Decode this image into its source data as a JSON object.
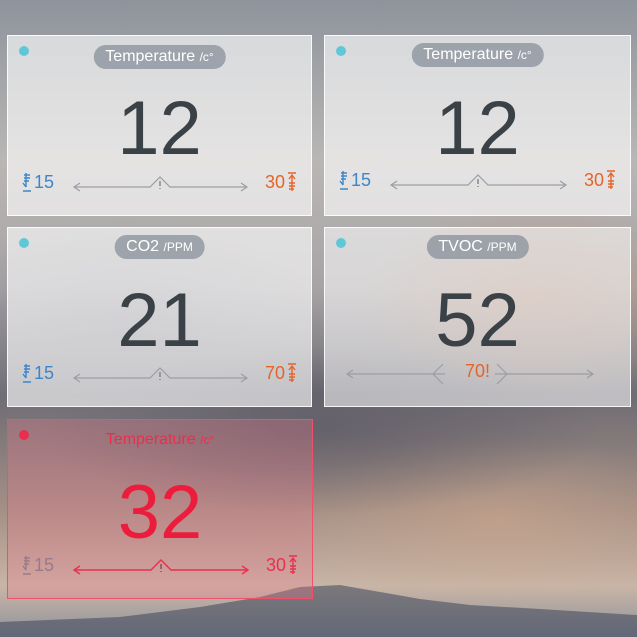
{
  "cards": [
    {
      "title": "Temperature",
      "unit": "/c°",
      "value": "12",
      "low": "15",
      "high": "30"
    },
    {
      "title": "Temperature",
      "unit": "/c°",
      "value": "12",
      "low": "15",
      "high": "30"
    },
    {
      "title": "CO2",
      "unit": "/PPM",
      "value": "21",
      "low": "15",
      "high": "70"
    },
    {
      "title": "TVOC",
      "unit": "/PPM",
      "value": "52",
      "threshold": "70!"
    },
    {
      "title": "Temperature",
      "unit": "/c°",
      "value": "32",
      "low": "15",
      "high": "30",
      "state": "alert"
    }
  ],
  "colors": {
    "indicator_normal": "#5fc8d6",
    "indicator_alert": "#e8304e",
    "low_threshold": "#3d86c9",
    "high_threshold": "#e5642b",
    "value_text": "#3b4247",
    "alert_text": "#ec1d3c"
  },
  "icons": {
    "indicator": "status-dot-icon",
    "low": "arrow-down-threshold-icon",
    "high": "arrow-up-threshold-icon",
    "range": "range-scale-icon"
  }
}
